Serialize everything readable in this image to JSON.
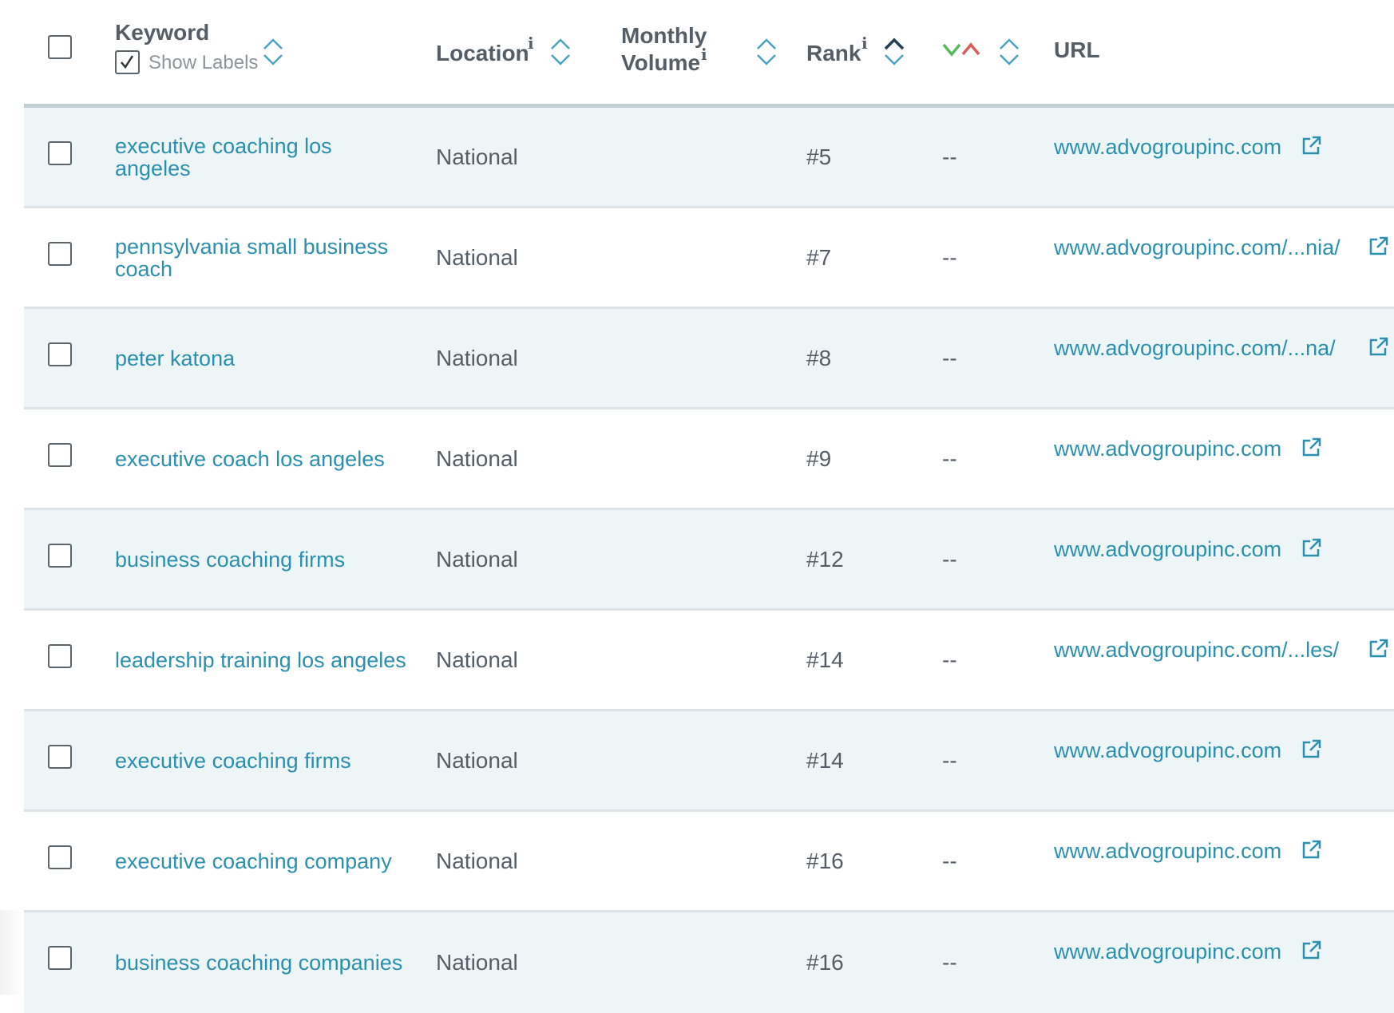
{
  "header": {
    "keyword": "Keyword",
    "show_labels": "Show Labels",
    "location": "Location",
    "monthly_volume_line1": "Monthly",
    "monthly_volume_line2": "Volume",
    "rank": "Rank",
    "url": "URL",
    "info_glyph": "i",
    "change_icon_colors": {
      "down": "#5cb85c",
      "up": "#e05a5a"
    },
    "active_sort": "rank-ascending"
  },
  "rows": [
    {
      "keyword": "executive coaching los angeles",
      "location": "National",
      "rank": "#5",
      "change": "--",
      "url": "www.advogroupinc.com"
    },
    {
      "keyword": "pennsylvania small business coach",
      "location": "National",
      "rank": "#7",
      "change": "--",
      "url": "www.advogroupinc.com/...nia/"
    },
    {
      "keyword": "peter katona",
      "location": "National",
      "rank": "#8",
      "change": "--",
      "url": "www.advogroupinc.com/...na/"
    },
    {
      "keyword": "executive coach los angeles",
      "location": "National",
      "rank": "#9",
      "change": "--",
      "url": "www.advogroupinc.com"
    },
    {
      "keyword": "business coaching firms",
      "location": "National",
      "rank": "#12",
      "change": "--",
      "url": "www.advogroupinc.com"
    },
    {
      "keyword": "leadership training los angeles",
      "location": "National",
      "rank": "#14",
      "change": "--",
      "url": "www.advogroupinc.com/...les/"
    },
    {
      "keyword": "executive coaching firms",
      "location": "National",
      "rank": "#14",
      "change": "--",
      "url": "www.advogroupinc.com"
    },
    {
      "keyword": "executive coaching company",
      "location": "National",
      "rank": "#16",
      "change": "--",
      "url": "www.advogroupinc.com"
    },
    {
      "keyword": "business coaching companies",
      "location": "National",
      "rank": "#16",
      "change": "--",
      "url": "www.advogroupinc.com"
    }
  ],
  "colors": {
    "link": "#2b8fb0",
    "text": "#555e66",
    "row_alt": "#eef5f7",
    "sort_icon": "#4aa3c0",
    "sort_active": "#1f3f55"
  }
}
